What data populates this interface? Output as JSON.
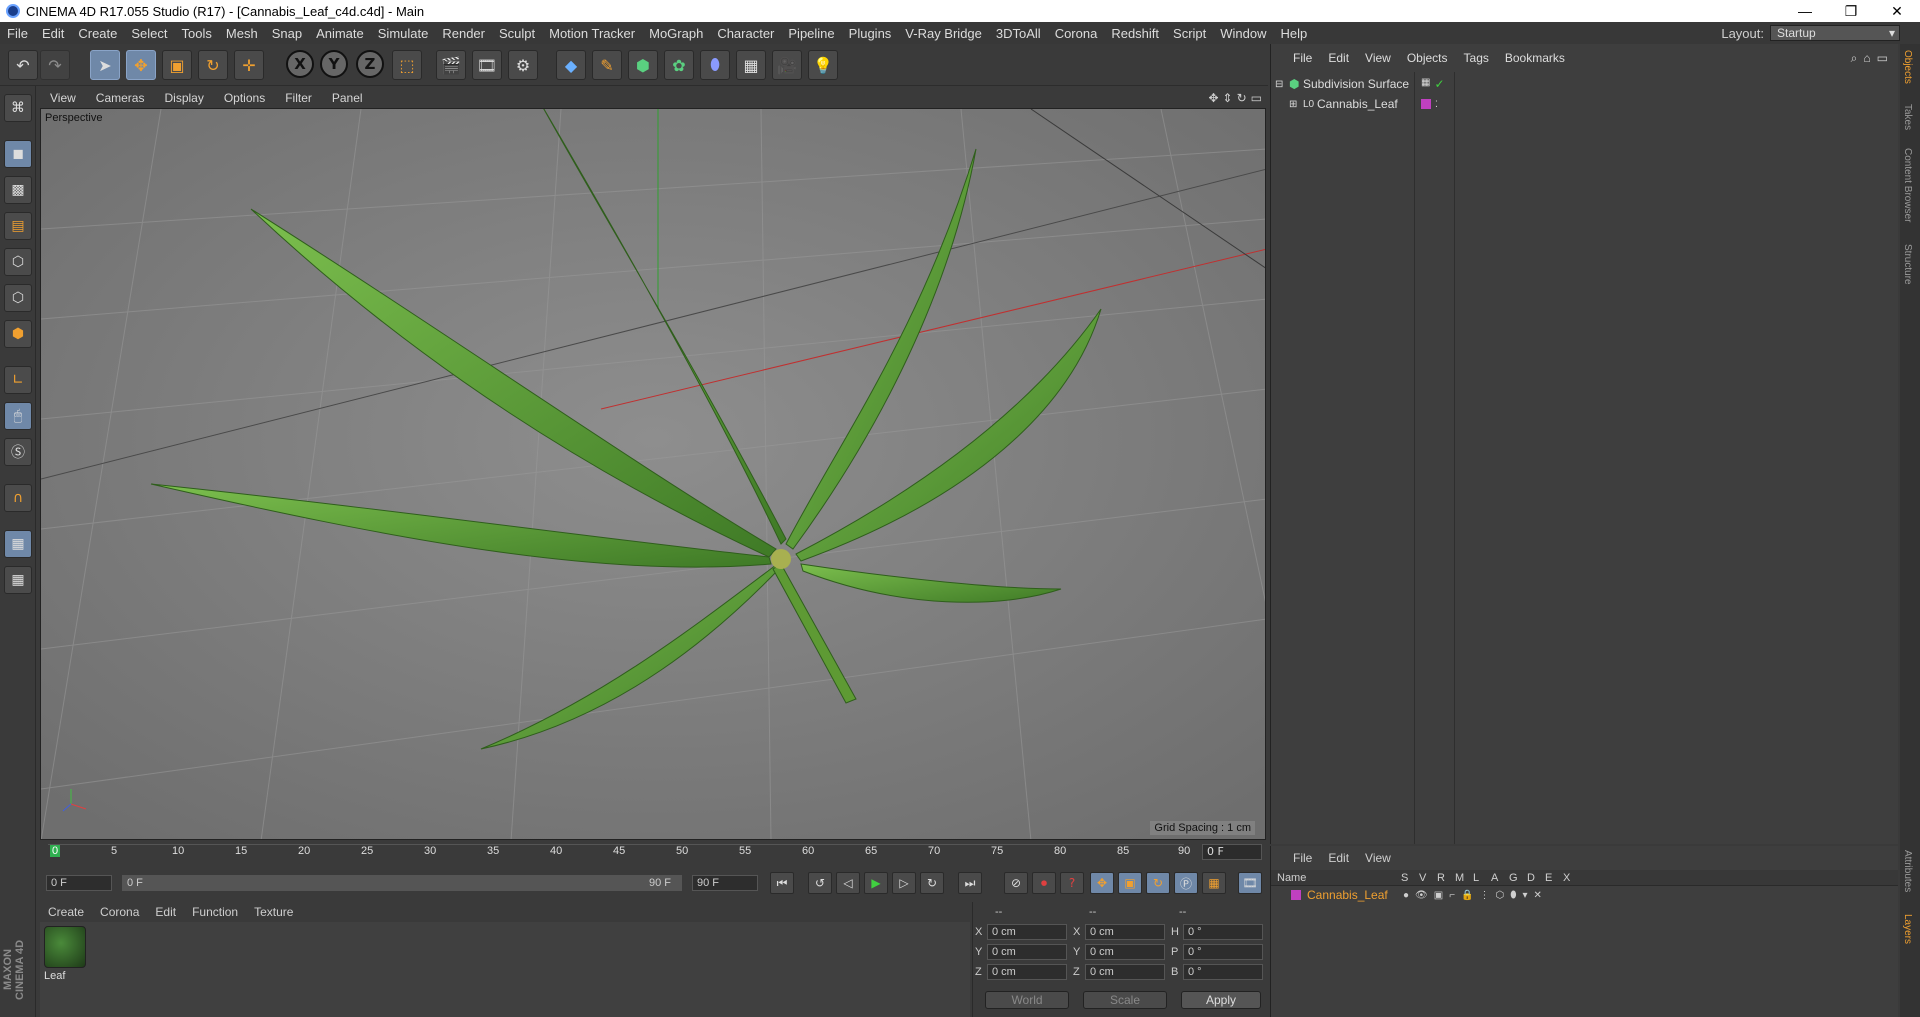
{
  "window": {
    "title": "CINEMA 4D R17.055 Studio (R17) - [Cannabis_Leaf_c4d.c4d] - Main",
    "min": "—",
    "restore": "❐",
    "close": "✕"
  },
  "menubar": {
    "items": [
      "File",
      "Edit",
      "Create",
      "Select",
      "Tools",
      "Mesh",
      "Snap",
      "Animate",
      "Simulate",
      "Render",
      "Sculpt",
      "Motion Tracker",
      "MoGraph",
      "Character",
      "Pipeline",
      "Plugins",
      "V-Ray Bridge",
      "3DToAll",
      "Corona",
      "Redshift",
      "Script",
      "Window",
      "Help"
    ],
    "layout_label": "Layout:",
    "layout_value": "Startup"
  },
  "toolbar": {
    "axis_x": "X",
    "axis_y": "Y",
    "axis_z": "Z"
  },
  "viewport": {
    "menu": [
      "View",
      "Cameras",
      "Display",
      "Options",
      "Filter",
      "Panel"
    ],
    "camera": "Perspective",
    "grid_spacing": "Grid Spacing : 1 cm"
  },
  "timeline": {
    "ticks": [
      "0",
      "5",
      "10",
      "15",
      "20",
      "25",
      "30",
      "35",
      "40",
      "45",
      "50",
      "55",
      "60",
      "65",
      "70",
      "75",
      "80",
      "85",
      "90"
    ],
    "current_frame": "0 F"
  },
  "transport": {
    "start": "0 F",
    "slider_left": "0 F",
    "slider_right": "90 F",
    "end": "90 F"
  },
  "material_manager": {
    "menu": [
      "Create",
      "Corona",
      "Edit",
      "Function",
      "Texture"
    ],
    "material_name": "Leaf"
  },
  "coordinates": {
    "headers": [
      "--",
      "--",
      "--"
    ],
    "rows": [
      {
        "l1": "X",
        "v1": "0 cm",
        "l2": "X",
        "v2": "0 cm",
        "l3": "H",
        "v3": "0 °"
      },
      {
        "l1": "Y",
        "v1": "0 cm",
        "l2": "Y",
        "v2": "0 cm",
        "l3": "P",
        "v3": "0 °"
      },
      {
        "l1": "Z",
        "v1": "0 cm",
        "l2": "Z",
        "v2": "0 cm",
        "l3": "B",
        "v3": "0 °"
      }
    ],
    "world": "World",
    "scale": "Scale",
    "apply": "Apply"
  },
  "object_manager": {
    "menu": [
      "File",
      "Edit",
      "View",
      "Objects",
      "Tags",
      "Bookmarks"
    ],
    "objects": [
      {
        "name": "Subdivision Surface"
      },
      {
        "name": "Cannabis_Leaf"
      }
    ]
  },
  "layer_manager": {
    "menu": [
      "File",
      "Edit",
      "View"
    ],
    "columns": [
      "Name",
      "S",
      "V",
      "R",
      "M",
      "L",
      "A",
      "G",
      "D",
      "E",
      "X"
    ],
    "layer_name": "Cannabis_Leaf",
    "layer_color": "#c040c0"
  },
  "side_tabs": [
    "Objects",
    "Takes",
    "Content Browser",
    "Structure"
  ],
  "side_tabs_bottom": [
    "Attributes",
    "Layers"
  ],
  "brand": "MAXON CINEMA 4D",
  "colors": {
    "highlight": "#6f88a8",
    "layer_name": "#f0a030",
    "leaf": "#5a9a38"
  }
}
